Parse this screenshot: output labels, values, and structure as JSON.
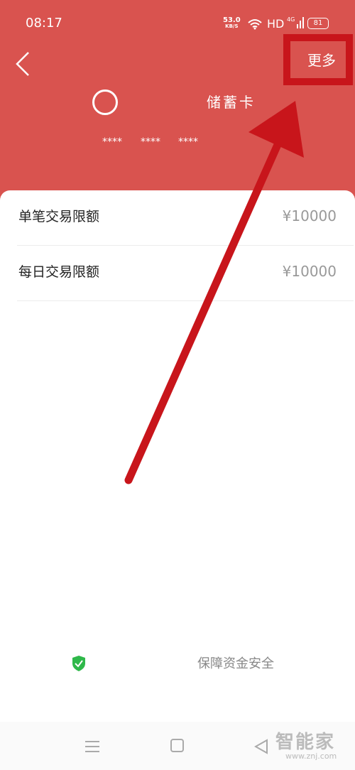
{
  "status_bar": {
    "time": "08:17",
    "net_speed_value": "53.0",
    "net_speed_unit": "KB/S",
    "hd": "HD",
    "network_type": "4G",
    "battery": "81"
  },
  "header": {
    "more_label": "更多",
    "card_type": "储蓄卡",
    "card_number_groups": [
      "****",
      "****",
      "****"
    ]
  },
  "limits": [
    {
      "label": "单笔交易限额",
      "value": "¥10000"
    },
    {
      "label": "每日交易限额",
      "value": "¥10000"
    }
  ],
  "security_note": "保障资金安全",
  "watermark": {
    "text": "智能家",
    "url": "www.znj.com"
  },
  "colors": {
    "header_bg": "#d9534f",
    "annotation": "#c8151b",
    "shield": "#2fb84a"
  },
  "icons": [
    "back-icon",
    "wifi-icon",
    "signal-icon",
    "bank-logo",
    "shield-icon",
    "nav-menu-icon",
    "nav-home-icon",
    "nav-back-icon"
  ]
}
